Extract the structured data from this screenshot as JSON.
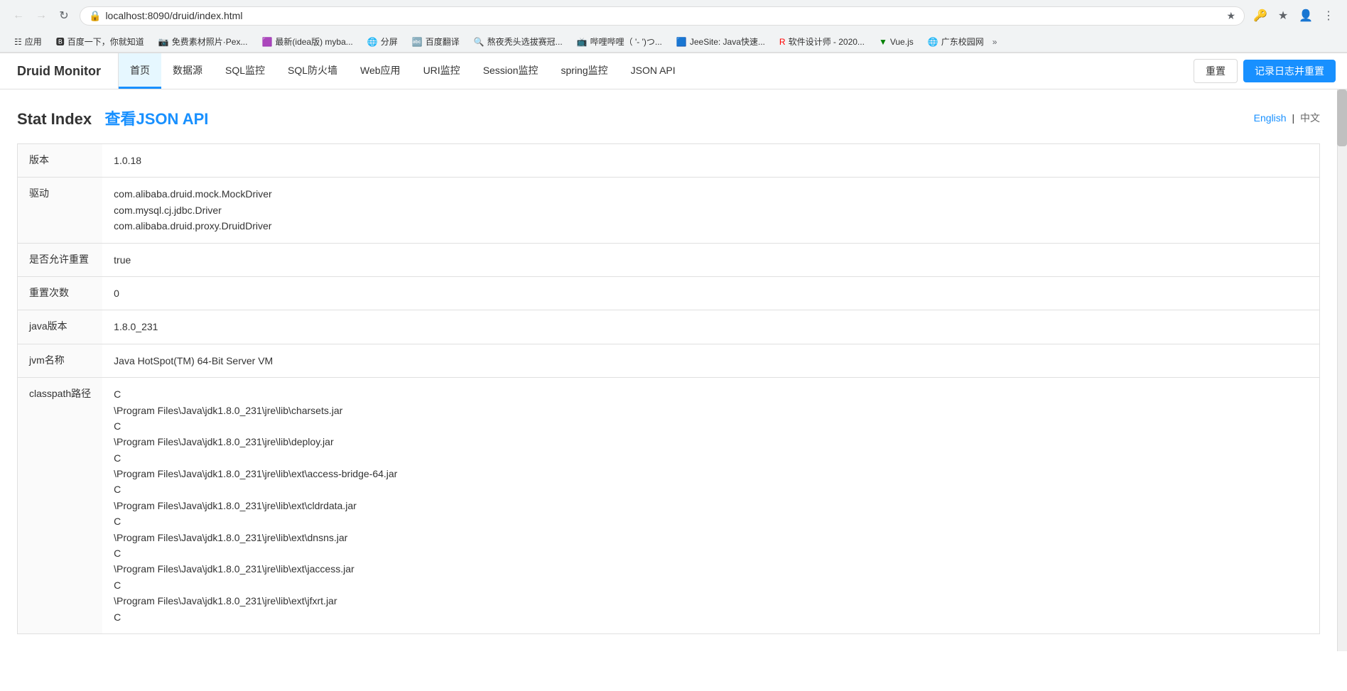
{
  "browser": {
    "url": "localhost:8090/druid/index.html",
    "back_disabled": true,
    "forward_disabled": true,
    "bookmarks": [
      {
        "label": "应用",
        "icon": "⬛"
      },
      {
        "label": "百度一下，你就知道",
        "icon": "🔵"
      },
      {
        "label": "免费素材照片·Pex...",
        "icon": "🟦"
      },
      {
        "label": "最新(idea版) myba...",
        "icon": "🟪"
      },
      {
        "label": "分屏",
        "icon": "🌐"
      },
      {
        "label": "百度翻译",
        "icon": "🟦"
      },
      {
        "label": "熬夜秃头选拔赛冠...",
        "icon": "🔍"
      },
      {
        "label": "哔哩哔哩（ '- ')つ...",
        "icon": "📺"
      },
      {
        "label": "JeeSite: Java快速...",
        "icon": "🟦"
      },
      {
        "label": "软件设计师 - 2020...",
        "icon": "🔴"
      },
      {
        "label": "Vue.js",
        "icon": "🟩"
      },
      {
        "label": "广东校园网",
        "icon": "🌐"
      }
    ]
  },
  "app": {
    "logo": "Druid Monitor",
    "nav_items": [
      {
        "label": "首页",
        "active": true
      },
      {
        "label": "数据源",
        "active": false
      },
      {
        "label": "SQL监控",
        "active": false
      },
      {
        "label": "SQL防火墙",
        "active": false
      },
      {
        "label": "Web应用",
        "active": false
      },
      {
        "label": "URI监控",
        "active": false
      },
      {
        "label": "Session监控",
        "active": false
      },
      {
        "label": "spring监控",
        "active": false
      },
      {
        "label": "JSON API",
        "active": false
      }
    ],
    "btn_reset": "重置",
    "btn_log_reset": "记录日志并重置"
  },
  "page": {
    "title": "Stat Index",
    "title_link_text": "查看JSON API",
    "title_link_href": "#",
    "lang_english": "English",
    "lang_chinese": "中文",
    "lang_separator": "|"
  },
  "table": {
    "rows": [
      {
        "label": "版本",
        "values": [
          "1.0.18"
        ]
      },
      {
        "label": "驱动",
        "values": [
          "com.alibaba.druid.mock.MockDriver",
          "com.mysql.cj.jdbc.Driver",
          "com.alibaba.druid.proxy.DruidDriver"
        ]
      },
      {
        "label": "是否允许重置",
        "values": [
          "true"
        ]
      },
      {
        "label": "重置次数",
        "values": [
          "0"
        ]
      },
      {
        "label": "java版本",
        "values": [
          "1.8.0_231"
        ]
      },
      {
        "label": "jvm名称",
        "values": [
          "Java HotSpot(TM) 64-Bit Server VM"
        ]
      },
      {
        "label": "classpath路径",
        "values": [
          "C",
          "\\Program Files\\Java\\jdk1.8.0_231\\jre\\lib\\charsets.jar",
          "C",
          "\\Program Files\\Java\\jdk1.8.0_231\\jre\\lib\\deploy.jar",
          "C",
          "\\Program Files\\Java\\jdk1.8.0_231\\jre\\lib\\ext\\access-bridge-64.jar",
          "C",
          "\\Program Files\\Java\\jdk1.8.0_231\\jre\\lib\\ext\\cldrdata.jar",
          "C",
          "\\Program Files\\Java\\jdk1.8.0_231\\jre\\lib\\ext\\dnsns.jar",
          "C",
          "\\Program Files\\Java\\jdk1.8.0_231\\jre\\lib\\ext\\jaccess.jar",
          "C",
          "\\Program Files\\Java\\jdk1.8.0_231\\jre\\lib\\ext\\jfxrt.jar",
          "C"
        ]
      }
    ]
  }
}
